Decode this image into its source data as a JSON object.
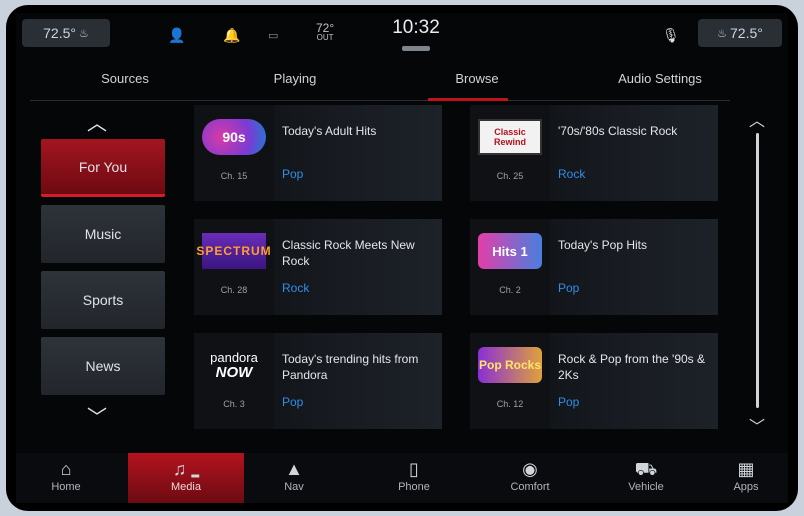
{
  "status": {
    "temp_left": "72.5°",
    "temp_right": "72.5°",
    "outside_temp": "72°",
    "outside_label": "OUT",
    "clock": "10:32"
  },
  "tabs": [
    {
      "label": "Sources"
    },
    {
      "label": "Playing"
    },
    {
      "label": "Browse"
    },
    {
      "label": "Audio Settings"
    }
  ],
  "active_tab": "Browse",
  "categories": [
    {
      "label": "For You",
      "active": true
    },
    {
      "label": "Music",
      "active": false
    },
    {
      "label": "Sports",
      "active": false
    },
    {
      "label": "News",
      "active": false
    }
  ],
  "stations": [
    {
      "logo": "90s",
      "channel": "Ch. 15",
      "description": "Today's Adult Hits",
      "genre": "Pop"
    },
    {
      "logo": "Classic Rewind",
      "channel": "Ch. 25",
      "description": "'70s/'80s Classic Rock",
      "genre": "Rock"
    },
    {
      "logo": "SPECTRUM",
      "channel": "Ch. 28",
      "description": "Classic Rock Meets New Rock",
      "genre": "Rock"
    },
    {
      "logo": "Hits 1",
      "channel": "Ch. 2",
      "description": "Today's Pop Hits",
      "genre": "Pop"
    },
    {
      "logo_line1": "pandora",
      "logo_line2": "NOW",
      "channel": "Ch. 3",
      "description": "Today's trending hits from Pandora",
      "genre": "Pop"
    },
    {
      "logo": "Pop Rocks",
      "channel": "Ch. 12",
      "description": "Rock & Pop from the '90s & 2Ks",
      "genre": "Pop"
    }
  ],
  "nav": [
    {
      "label": "Home",
      "icon": "home-icon",
      "active": false
    },
    {
      "label": "Media",
      "icon": "music-note-icon",
      "active": true
    },
    {
      "label": "Nav",
      "icon": "navigation-arrow-icon",
      "active": false
    },
    {
      "label": "Phone",
      "icon": "phone-icon",
      "active": false
    },
    {
      "label": "Comfort",
      "icon": "comfort-icon",
      "active": false
    },
    {
      "label": "Vehicle",
      "icon": "vehicle-icon",
      "active": false
    },
    {
      "label": "Apps",
      "icon": "apps-grid-icon",
      "active": false
    }
  ],
  "colors": {
    "accent_red": "#c0121d",
    "genre_blue": "#2f8ee8",
    "background": "#050608"
  }
}
